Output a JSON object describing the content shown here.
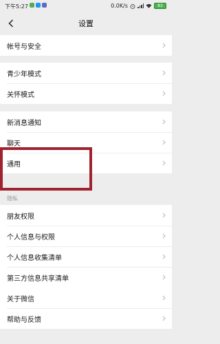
{
  "status_bar": {
    "time": "下午5:27",
    "network_speed": "0.0K/s",
    "battery": "83",
    "app_icon_colors": [
      "#4caf50",
      "#2196f3",
      "#5c6bc0"
    ]
  },
  "header": {
    "title": "设置",
    "back_icon": "chevron-left-icon"
  },
  "groups": [
    {
      "items": [
        "帐号与安全"
      ]
    },
    {
      "items": [
        "青少年模式",
        "关怀模式"
      ]
    },
    {
      "items": [
        "新消息通知",
        "聊天",
        "通用"
      ]
    },
    {
      "section_label": "隐私",
      "items": [
        "朋友权限",
        "个人信息与权限",
        "个人信息收集清单",
        "第三方信息共享清单"
      ]
    },
    {
      "items": [
        "关于微信",
        "帮助与反馈"
      ]
    }
  ],
  "highlight_color": "#a1222f"
}
